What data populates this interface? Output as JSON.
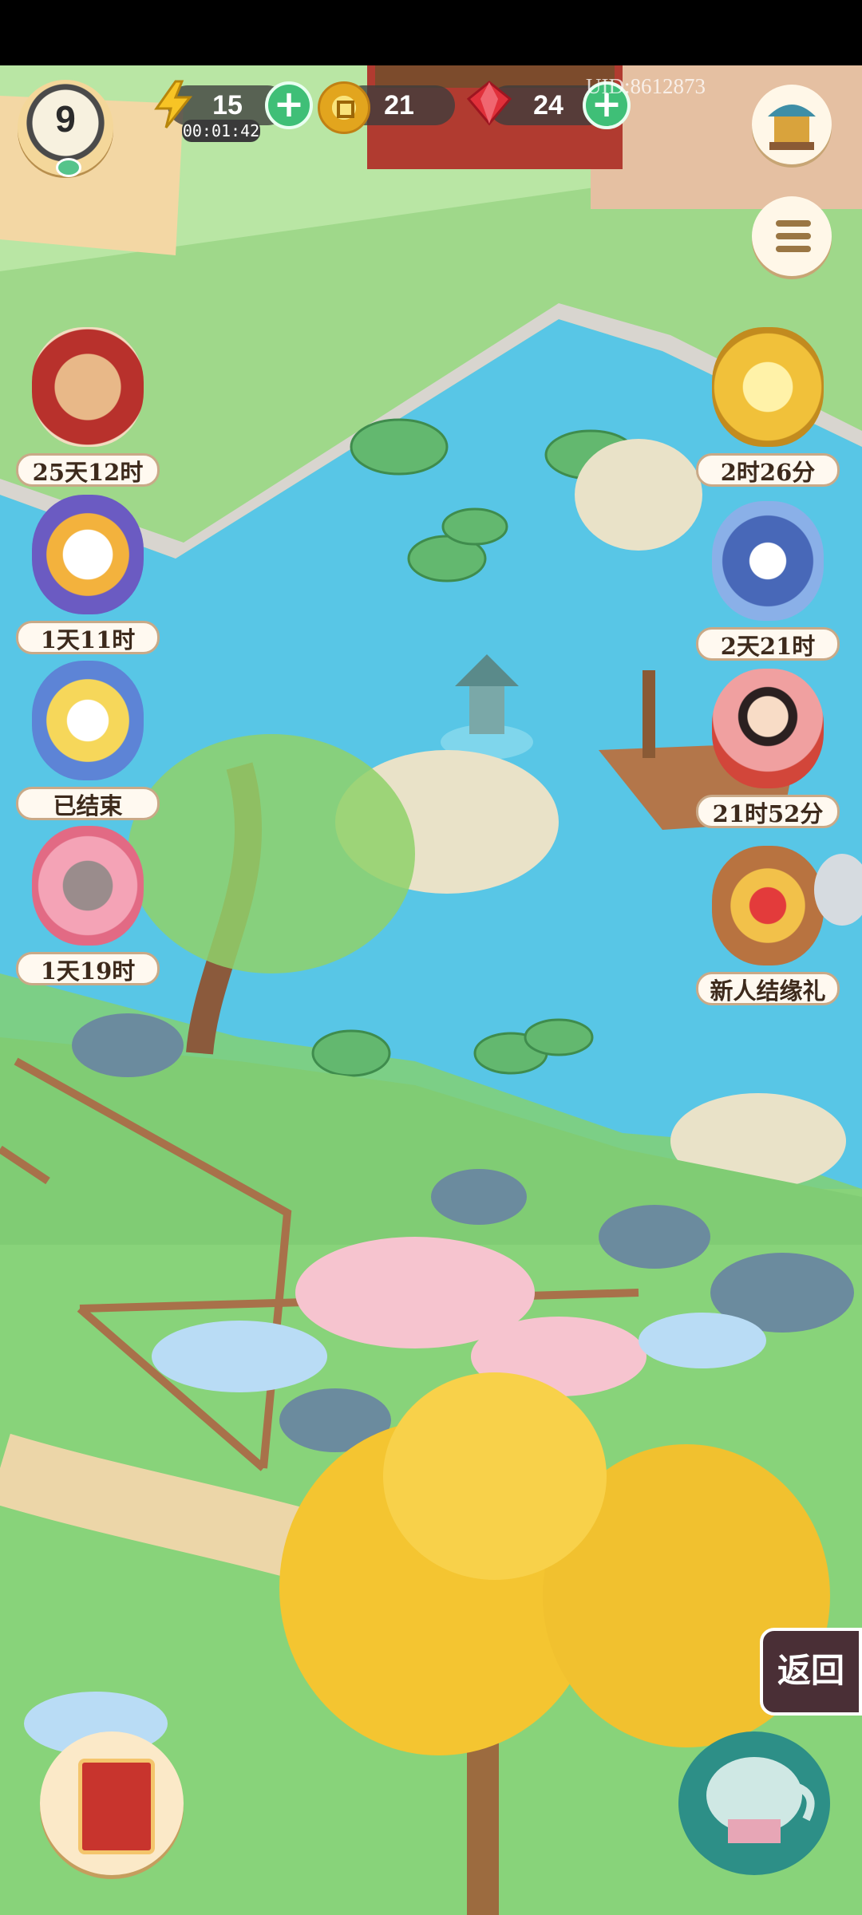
{
  "hud": {
    "level": "9",
    "energy": "15",
    "energy_timer": "00:01:42",
    "coins": "21",
    "gems": "24",
    "uid": "UID:8612873"
  },
  "events_left": [
    {
      "name": "event-scroll-box",
      "label": "25天12时"
    },
    {
      "name": "event-rabbit-lantern",
      "label": "1天11时"
    },
    {
      "name": "event-moon-rabbit",
      "label": "已结束"
    },
    {
      "name": "event-mouse-gift",
      "label": "1天19时"
    }
  ],
  "events_right": [
    {
      "name": "event-golden-chest",
      "label": "2时26分"
    },
    {
      "name": "event-rabbit-chest",
      "label": "2天21时"
    },
    {
      "name": "event-lady-portrait",
      "label": "21时52分"
    },
    {
      "name": "event-newbie-gift",
      "label": "新人结缘礼"
    }
  ],
  "buttons": {
    "back": "返回"
  },
  "icons": {
    "energy": "lightning-icon",
    "coin": "coin-icon",
    "gem": "ruby-icon",
    "shop": "shop-icon",
    "menu": "menu-list-icon",
    "book": "book-icon",
    "tea": "teapot-icon"
  }
}
